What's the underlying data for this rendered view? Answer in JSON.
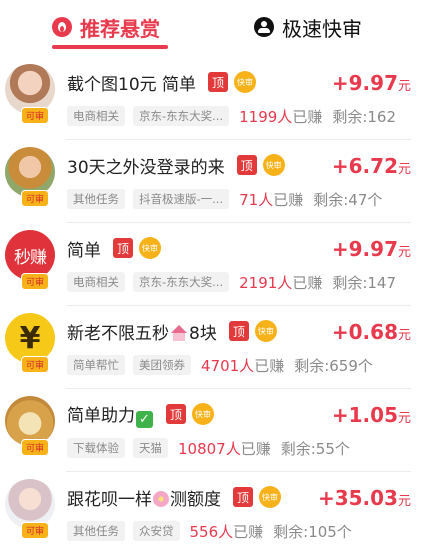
{
  "tabs": [
    {
      "label": "推荐悬赏",
      "icon": "flame-icon",
      "active": true
    },
    {
      "label": "极速快审",
      "icon": "user-icon",
      "active": false
    }
  ],
  "colors": {
    "accent": "#e8394d",
    "top_tag": "#e23a3a",
    "fast_badge": "#f7b21a"
  },
  "badges": {
    "top": "顶",
    "fast": "快审",
    "avatar_fast": "可审"
  },
  "tasks": [
    {
      "title": "截个图10元 简单",
      "reward": "+9.97",
      "unit": "元",
      "tags": [
        "电商相关",
        "京东-东东大奖..."
      ],
      "earned": "1199人",
      "earned_suffix": "已赚",
      "remaining": "剩余:162",
      "avatar_text": ""
    },
    {
      "title": "30天之外没登录的来",
      "reward": "+6.72",
      "unit": "元",
      "tags": [
        "其他任务",
        "抖音极速版-一..."
      ],
      "earned": "71人",
      "earned_suffix": "已赚",
      "remaining": "剩余:47个",
      "avatar_text": ""
    },
    {
      "title": "简单",
      "reward": "+9.97",
      "unit": "元",
      "tags": [
        "电商相关",
        "京东-东东大奖..."
      ],
      "earned": "2191人",
      "earned_suffix": "已赚",
      "remaining": "剩余:147",
      "avatar_text": "秒赚"
    },
    {
      "title_a": "新老不限五秒",
      "title_b": "8块",
      "reward": "+0.68",
      "unit": "元",
      "tags": [
        "简单帮忙",
        "美团领券"
      ],
      "earned": "4701人",
      "earned_suffix": "已赚",
      "remaining": "剩余:659个",
      "avatar_text": "¥"
    },
    {
      "title_a": "简单助力",
      "reward": "+1.05",
      "unit": "元",
      "tags": [
        "下载体验",
        "天猫"
      ],
      "earned": "10807人",
      "earned_suffix": "已赚",
      "remaining": "剩余:55个",
      "avatar_text": ""
    },
    {
      "title_a": "跟花呗一样",
      "title_b": "测额度",
      "reward": "+35.03",
      "unit": "元",
      "tags": [
        "其他任务",
        "众安贷"
      ],
      "earned": "556人",
      "earned_suffix": "已赚",
      "remaining": "剩余:105个",
      "avatar_text": ""
    }
  ]
}
